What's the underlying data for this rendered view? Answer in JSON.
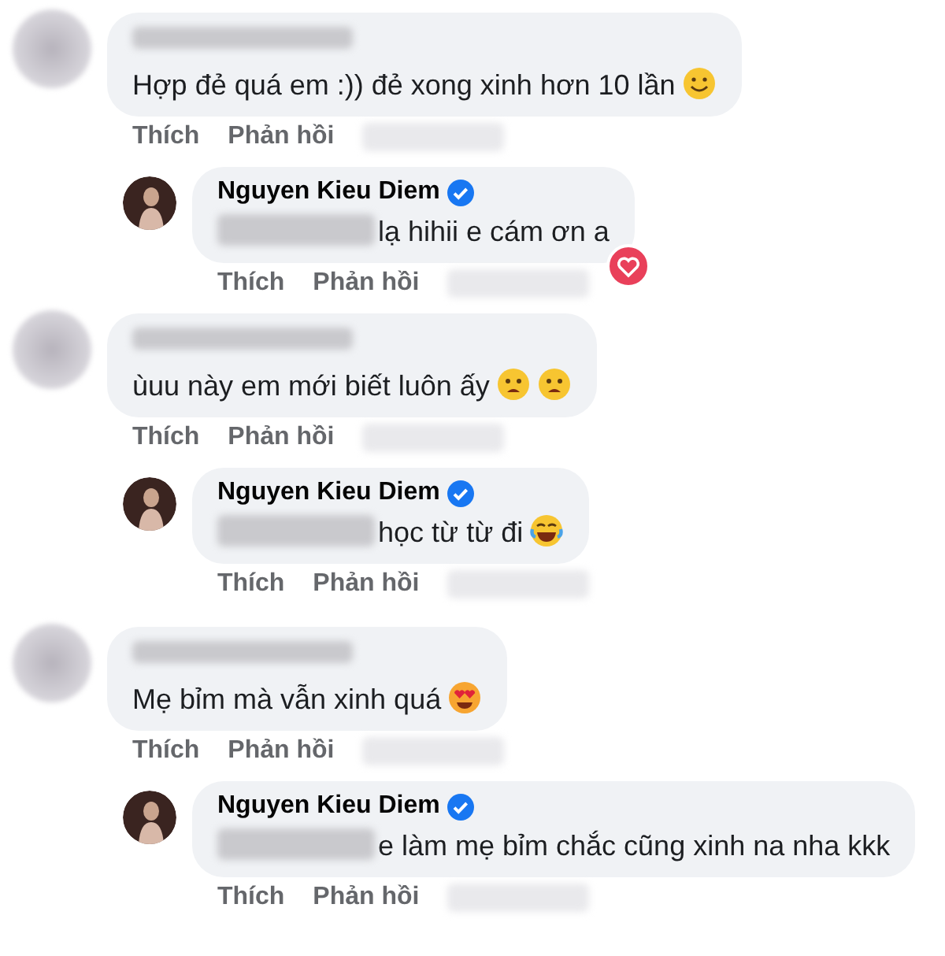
{
  "threads": [
    {
      "comment": {
        "text": "Hợp đẻ quá em :)) đẻ xong xinh hơn 10 lần",
        "emoji": [
          {
            "kind": "smile"
          }
        ],
        "actions": [
          "Thích",
          "Phản hồi"
        ]
      },
      "reply": {
        "author": "Nguyen Kieu Diem",
        "verified": true,
        "redacted_prefix": true,
        "text": "lạ hihii e cám ơn a",
        "reaction": {
          "kind": "love"
        },
        "actions": [
          "Thích",
          "Phản hồi"
        ]
      }
    },
    {
      "comment": {
        "text": "ùuu này em mới biết luôn ấy",
        "emoji": [
          {
            "kind": "frown"
          },
          {
            "kind": "frown"
          }
        ],
        "actions": [
          "Thích",
          "Phản hồi"
        ]
      },
      "reply": {
        "author": "Nguyen Kieu Diem",
        "verified": true,
        "redacted_prefix": true,
        "text": "học từ từ đi",
        "emoji": [
          {
            "kind": "joy"
          }
        ],
        "actions": [
          "Thích",
          "Phản hồi"
        ]
      }
    },
    {
      "comment": {
        "text": "Mẹ bỉm mà vẫn xinh quá",
        "emoji": [
          {
            "kind": "heart-eyes"
          }
        ],
        "actions": [
          "Thích",
          "Phản hồi"
        ]
      },
      "reply": {
        "author": "Nguyen Kieu Diem",
        "verified": true,
        "redacted_prefix": true,
        "text": "e làm mẹ bỉm chắc cũng xinh na nha kkk",
        "actions": [
          "Thích",
          "Phản hồi"
        ]
      }
    }
  ]
}
